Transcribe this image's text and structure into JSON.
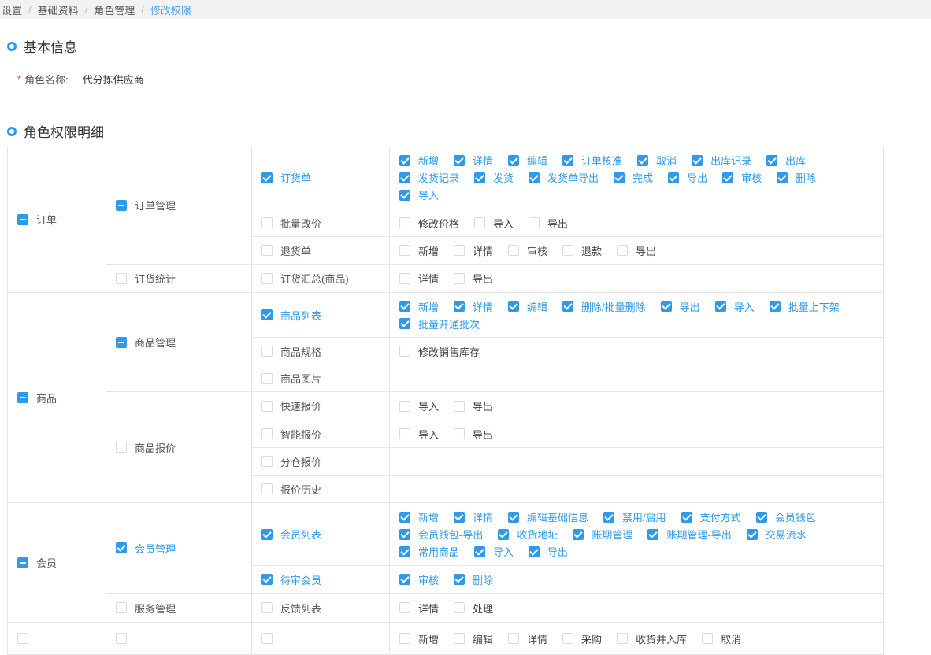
{
  "breadcrumb": [
    "设置",
    "基础资料",
    "角色管理",
    "修改权限"
  ],
  "basic": {
    "title": "基本信息",
    "role_label": "角色名称:",
    "role_value": "代分拣供应商"
  },
  "perm_title": "角色权限明细",
  "groups": [
    {
      "label": "订单",
      "state": "half",
      "modules": [
        {
          "label": "订单管理",
          "state": "half",
          "pages": [
            {
              "label": "订货单",
              "checked": true,
              "actions": [
                {
                  "label": "新增",
                  "checked": true
                },
                {
                  "label": "详情",
                  "checked": true
                },
                {
                  "label": "编辑",
                  "checked": true
                },
                {
                  "label": "订单核准",
                  "checked": true
                },
                {
                  "label": "取消",
                  "checked": true
                },
                {
                  "label": "出库记录",
                  "checked": true
                },
                {
                  "label": "出库",
                  "checked": true
                },
                {
                  "label": "发货记录",
                  "checked": true
                },
                {
                  "label": "发货",
                  "checked": true
                },
                {
                  "label": "发货单导出",
                  "checked": true
                },
                {
                  "label": "完成",
                  "checked": true
                },
                {
                  "label": "导出",
                  "checked": true
                },
                {
                  "label": "审核",
                  "checked": true
                },
                {
                  "label": "删除",
                  "checked": true
                },
                {
                  "label": "导入",
                  "checked": true
                }
              ]
            },
            {
              "label": "批量改价",
              "checked": false,
              "actions": [
                {
                  "label": "修改价格",
                  "checked": false
                },
                {
                  "label": "导入",
                  "checked": false
                },
                {
                  "label": "导出",
                  "checked": false
                }
              ]
            },
            {
              "label": "退货单",
              "checked": false,
              "actions": [
                {
                  "label": "新增",
                  "checked": false
                },
                {
                  "label": "详情",
                  "checked": false
                },
                {
                  "label": "审核",
                  "checked": false
                },
                {
                  "label": "退款",
                  "checked": false
                },
                {
                  "label": "导出",
                  "checked": false
                }
              ]
            }
          ]
        },
        {
          "label": "订货统计",
          "state": "off",
          "pages": [
            {
              "label": "订货汇总(商品)",
              "checked": false,
              "actions": [
                {
                  "label": "详情",
                  "checked": false
                },
                {
                  "label": "导出",
                  "checked": false
                }
              ]
            }
          ]
        }
      ]
    },
    {
      "label": "商品",
      "state": "half",
      "modules": [
        {
          "label": "商品管理",
          "state": "half",
          "pages": [
            {
              "label": "商品列表",
              "checked": true,
              "actions": [
                {
                  "label": "新增",
                  "checked": true
                },
                {
                  "label": "详情",
                  "checked": true
                },
                {
                  "label": "编辑",
                  "checked": true
                },
                {
                  "label": "删除/批量删除",
                  "checked": true
                },
                {
                  "label": "导出",
                  "checked": true
                },
                {
                  "label": "导入",
                  "checked": true
                },
                {
                  "label": "批量上下架",
                  "checked": true
                },
                {
                  "label": "批量开通批次",
                  "checked": true
                }
              ]
            },
            {
              "label": "商品规格",
              "checked": false,
              "actions": [
                {
                  "label": "修改销售库存",
                  "checked": false
                }
              ]
            },
            {
              "label": "商品图片",
              "checked": false,
              "actions": []
            }
          ]
        },
        {
          "label": "商品报价",
          "state": "off",
          "pages": [
            {
              "label": "快速报价",
              "checked": false,
              "actions": [
                {
                  "label": "导入",
                  "checked": false
                },
                {
                  "label": "导出",
                  "checked": false
                }
              ]
            },
            {
              "label": "智能报价",
              "checked": false,
              "actions": [
                {
                  "label": "导入",
                  "checked": false
                },
                {
                  "label": "导出",
                  "checked": false
                }
              ]
            },
            {
              "label": "分仓报价",
              "checked": false,
              "actions": []
            },
            {
              "label": "报价历史",
              "checked": false,
              "actions": []
            }
          ]
        }
      ]
    },
    {
      "label": "会员",
      "state": "half",
      "modules": [
        {
          "label": "会员管理",
          "state": "on",
          "pages": [
            {
              "label": "会员列表",
              "checked": true,
              "actions": [
                {
                  "label": "新增",
                  "checked": true
                },
                {
                  "label": "详情",
                  "checked": true
                },
                {
                  "label": "编辑基础信息",
                  "checked": true
                },
                {
                  "label": "禁用/启用",
                  "checked": true
                },
                {
                  "label": "支付方式",
                  "checked": true
                },
                {
                  "label": "会员钱包",
                  "checked": true
                },
                {
                  "label": "会员钱包-导出",
                  "checked": true
                },
                {
                  "label": "收货地址",
                  "checked": true
                },
                {
                  "label": "账期管理",
                  "checked": true
                },
                {
                  "label": "账期管理-导出",
                  "checked": true
                },
                {
                  "label": "交易流水",
                  "checked": true
                },
                {
                  "label": "常用商品",
                  "checked": true
                },
                {
                  "label": "导入",
                  "checked": true
                },
                {
                  "label": "导出",
                  "checked": true
                }
              ]
            },
            {
              "label": "待审会员",
              "checked": true,
              "actions": [
                {
                  "label": "审核",
                  "checked": true
                },
                {
                  "label": "删除",
                  "checked": true
                }
              ]
            }
          ]
        },
        {
          "label": "服务管理",
          "state": "off",
          "pages": [
            {
              "label": "反馈列表",
              "checked": false,
              "actions": [
                {
                  "label": "详情",
                  "checked": false
                },
                {
                  "label": "处理",
                  "checked": false
                }
              ]
            }
          ]
        }
      ]
    },
    {
      "label": "",
      "state": "off",
      "modules": [
        {
          "label": "",
          "state": "off",
          "pages": [
            {
              "label": "",
              "checked": false,
              "actions": [
                {
                  "label": "新增",
                  "checked": false
                },
                {
                  "label": "编辑",
                  "checked": false
                },
                {
                  "label": "详情",
                  "checked": false
                },
                {
                  "label": "采购",
                  "checked": false
                },
                {
                  "label": "收货并入库",
                  "checked": false
                },
                {
                  "label": "取消",
                  "checked": false
                }
              ]
            }
          ]
        }
      ]
    }
  ]
}
